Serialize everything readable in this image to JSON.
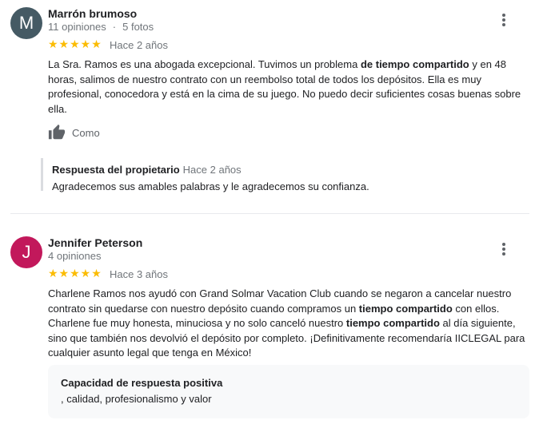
{
  "reviews": [
    {
      "avatar_letter": "M",
      "avatar_color": "#455a64",
      "name": "Marrón brumoso",
      "review_count": "11 opiniones",
      "separator": "·",
      "photo_count": "5 fotos",
      "rating": 5,
      "stars": "★★★★★",
      "age": "Hace 2 años",
      "text": [
        {
          "t": "La Sra. Ramos es una abogada excepcional. Tuvimos un problema ",
          "b": false
        },
        {
          "t": "de tiempo compartido",
          "b": true
        },
        {
          "t": " y en 48 horas, salimos de nuestro contrato con un reembolso total de todos los depósitos. Ella es muy profesional, conocedora y está en la cima de su juego. No puedo decir suficientes cosas buenas sobre ella.",
          "b": false
        }
      ],
      "like_label": "Como",
      "owner_reply": {
        "title": "Respuesta del propietario",
        "age": "Hace 2 años",
        "text": "Agradecemos sus amables palabras y le agradecemos su confianza."
      }
    },
    {
      "avatar_letter": "J",
      "avatar_color": "#c2185b",
      "name": "Jennifer Peterson",
      "review_count": "4 opiniones",
      "rating": 5,
      "stars": "★★★★★",
      "age": "Hace 3 años",
      "text": [
        {
          "t": "Charlene Ramos nos ayudó con Grand Solmar Vacation Club cuando se negaron a cancelar nuestro contrato sin quedarse con nuestro depósito cuando compramos un ",
          "b": false
        },
        {
          "t": "tiempo compartido",
          "b": true
        },
        {
          "t": " con ellos. Charlene fue muy honesta, minuciosa y no solo canceló nuestro ",
          "b": false
        },
        {
          "t": "tiempo compartido",
          "b": true
        },
        {
          "t": " al día siguiente, sino que también nos devolvió el depósito por completo. ¡Definitivamente recomendaría IICLEGAL para cualquier asunto legal que tenga en México!",
          "b": false
        }
      ],
      "attributes": {
        "title": "Capacidad de respuesta positiva",
        "values": ", calidad, profesionalismo y valor"
      }
    }
  ]
}
